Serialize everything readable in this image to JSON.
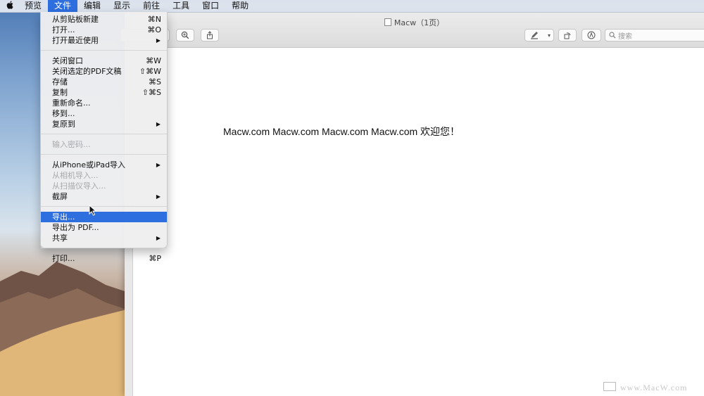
{
  "menubar": {
    "items": [
      "预览",
      "文件",
      "编辑",
      "显示",
      "前往",
      "工具",
      "窗口",
      "帮助"
    ],
    "active": "文件"
  },
  "window": {
    "title": "Macw（1页）",
    "search_placeholder": "搜索"
  },
  "file_menu": {
    "groups": [
      [
        {
          "label": "从剪贴板新建",
          "shortcut": "⌘N"
        },
        {
          "label": "打开...",
          "shortcut": "⌘O"
        },
        {
          "label": "打开最近使用",
          "submenu": true
        }
      ],
      [
        {
          "label": "关闭窗口",
          "shortcut": "⌘W"
        },
        {
          "label": "关闭选定的PDF文稿",
          "shortcut": "⇧⌘W"
        },
        {
          "label": "存储",
          "shortcut": "⌘S"
        },
        {
          "label": "复制",
          "shortcut": "⇧⌘S"
        },
        {
          "label": "重新命名..."
        },
        {
          "label": "移到..."
        },
        {
          "label": "复原到",
          "submenu": true
        }
      ],
      [
        {
          "label": "输入密码...",
          "disabled": true
        }
      ],
      [
        {
          "label": "从iPhone或iPad导入",
          "submenu": true
        },
        {
          "label": "从相机导入...",
          "disabled": true
        },
        {
          "label": "从扫描仪导入...",
          "disabled": true
        },
        {
          "label": "截屏",
          "submenu": true
        }
      ],
      [
        {
          "label": "导出...",
          "highlighted": true
        },
        {
          "label": "导出为 PDF..."
        },
        {
          "label": "共享",
          "submenu": true
        }
      ],
      [
        {
          "label": "打印...",
          "shortcut": "⌘P"
        }
      ]
    ]
  },
  "document": {
    "text": "Macw.com Macw.com Macw.com Macw.com 欢迎您！"
  },
  "watermark": "www.MacW.com",
  "colors": {
    "highlight": "#2e6fe0",
    "disabled_text": "#a9a9ad"
  }
}
